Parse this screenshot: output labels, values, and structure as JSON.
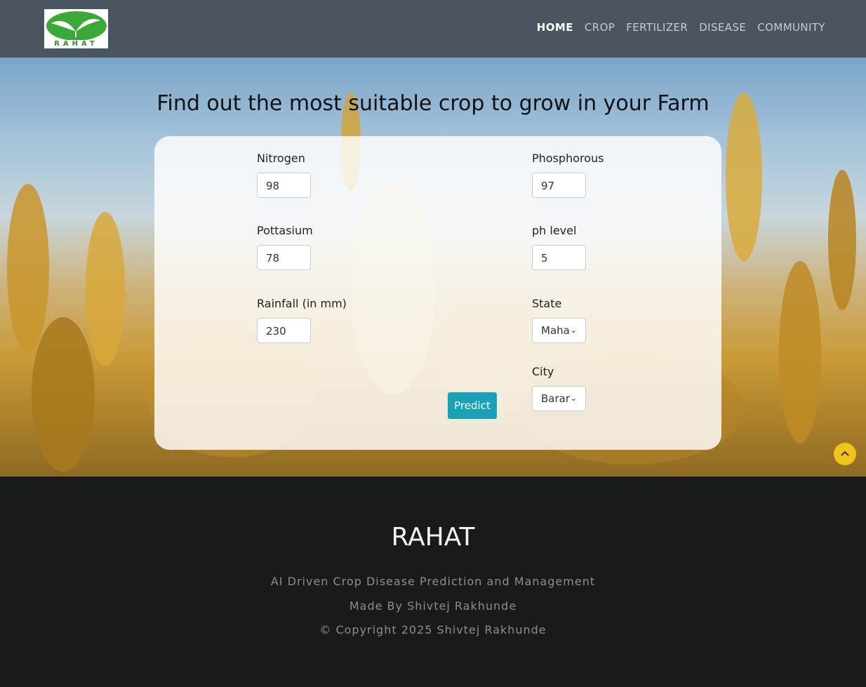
{
  "brand": {
    "logo_text": "RAHAT"
  },
  "nav": {
    "items": [
      {
        "label": "HOME",
        "active": true
      },
      {
        "label": "CROP",
        "active": false
      },
      {
        "label": "FERTILIZER",
        "active": false
      },
      {
        "label": "DISEASE",
        "active": false
      },
      {
        "label": "COMMUNITY",
        "active": false
      }
    ]
  },
  "main": {
    "heading": "Find out the most suitable crop to grow in your Farm",
    "form": {
      "nitrogen": {
        "label": "Nitrogen",
        "value": "98"
      },
      "phosphorous": {
        "label": "Phosphorous",
        "value": "97"
      },
      "pottasium": {
        "label": "Pottasium",
        "value": "78"
      },
      "ph": {
        "label": "ph level",
        "value": "5"
      },
      "rainfall": {
        "label": "Rainfall (in mm)",
        "value": "230"
      },
      "state": {
        "label": "State",
        "value": "Maha"
      },
      "city": {
        "label": "City",
        "value": "Barar"
      },
      "predict_label": "Predict"
    }
  },
  "footer": {
    "title": "RAHAT",
    "tagline": "AI Driven Crop Disease Prediction and Management",
    "made_by": "Made By Shivtej Rakhunde",
    "copyright": "© Copyright 2025 Shivtej Rakhunde"
  },
  "colors": {
    "navbar": "#4a5560",
    "accent": "#17a2b8",
    "scroll_top": "#f0c419",
    "footer": "#181a1b"
  },
  "icons": {
    "scroll_top": "chevron-up-icon",
    "select": "chevron-down-icon"
  }
}
